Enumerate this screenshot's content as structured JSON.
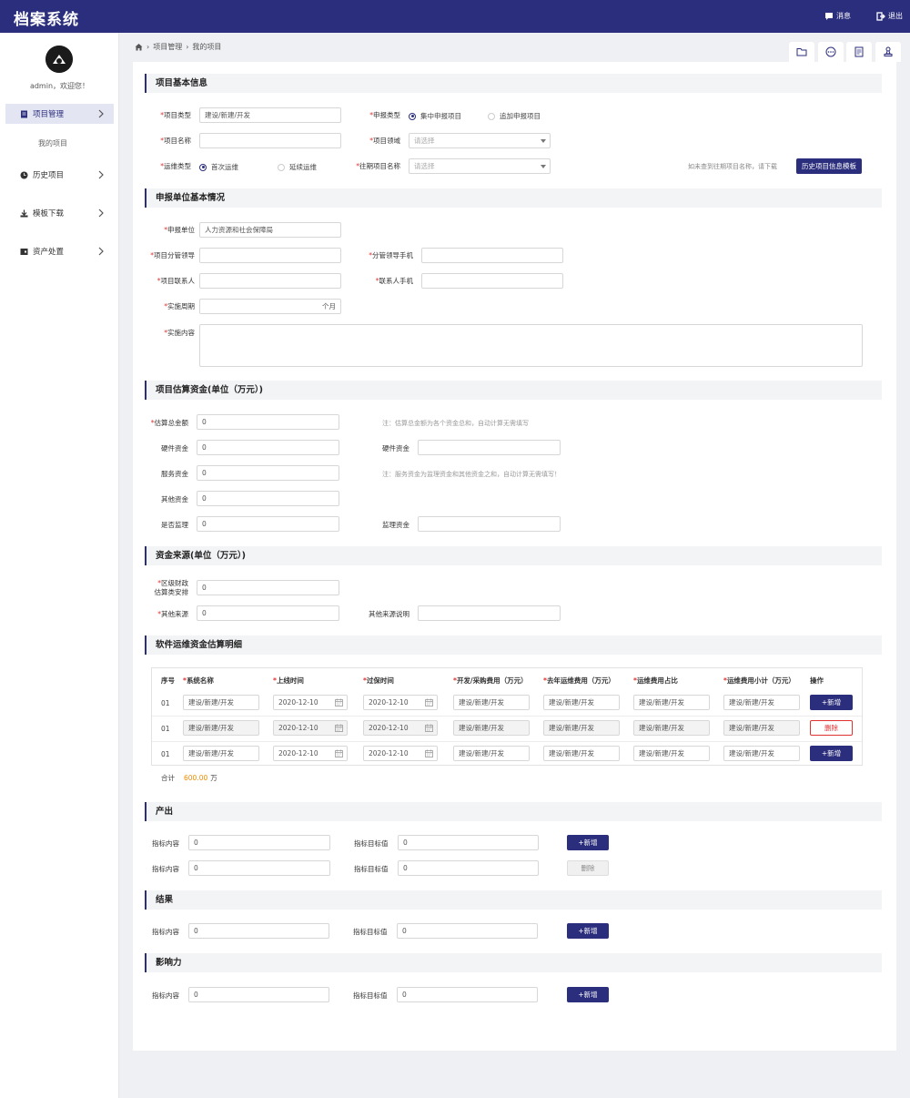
{
  "header": {
    "title": "档案系统",
    "messages_label": "消息",
    "logout_label": "退出"
  },
  "sidebar": {
    "welcome": "admin，欢迎您！",
    "items": [
      {
        "label": "项目管理"
      },
      {
        "label": "历史项目"
      },
      {
        "label": "模板下载"
      },
      {
        "label": "资产处置"
      }
    ],
    "sub_items": [
      {
        "label": "我的项目"
      }
    ]
  },
  "breadcrumb": {
    "items": [
      "项目管理",
      "我的项目"
    ]
  },
  "sections": {
    "basic": "项目基本信息",
    "unit": "申报单位基本情况",
    "budget": "项目估算资金(单位（万元）)",
    "source": "资金来源(单位（万元）)",
    "detail": "软件运维资金估算明细",
    "output": "产出",
    "result": "结果",
    "impact": "影响力"
  },
  "basic": {
    "project_type_label": "项目类型",
    "project_type_value": "建设/新建/开发",
    "apply_type_label": "申报类型",
    "apply_type_opt1": "集中申报项目",
    "apply_type_opt2": "追加申报项目",
    "project_name_label": "项目名称",
    "project_field_label": "项目领域",
    "project_field_placeholder": "请选择",
    "ops_type_label": "运维类型",
    "ops_opt1": "首次运维",
    "ops_opt2": "延续运维",
    "past_name_label": "往期项目名称",
    "past_name_placeholder": "请选择",
    "hint": "如未查到往期项目名称，请下载",
    "history_button": "历史项目信息模板"
  },
  "unit": {
    "apply_unit_label": "申报单位",
    "apply_unit_value": "人力资源和社会保障局",
    "leader_label": "项目分管领导",
    "leader_phone_label": "分管领导手机",
    "contact_label": "项目联系人",
    "contact_phone_label": "联系人手机",
    "period_label": "实施周期",
    "period_unit": "个月",
    "content_label": "实施内容"
  },
  "budget": {
    "total_label": "估算总金额",
    "total_value": "0",
    "total_note": "注：估算总金额为各个资金总和，自动计算无需填写",
    "hardware_label": "硬件资金",
    "hardware_value": "0",
    "hardware2_label": "硬件资金",
    "service_label": "服务资金",
    "service_value": "0",
    "service_note": "注：服务资金为监理资金和其他资金之和，自动计算无需填写！",
    "other_label": "其他资金",
    "other_value": "0",
    "supervise_flag_label": "是否监理",
    "supervise_flag_value": "0",
    "supervise_fund_label": "监理资金"
  },
  "source": {
    "district_label_1": "区级财政",
    "district_label_2": "估算类安排",
    "district_value": "0",
    "other_label": "其他来源",
    "other_value": "0",
    "other_desc_label": "其他来源说明"
  },
  "detail": {
    "headers": [
      "序号",
      "系统名称",
      "上线时间",
      "过保时间",
      "开发/采购费用（万元）",
      "去年运维费用（万元）",
      "运维费用占比",
      "运维费用小计（万元）",
      "操作"
    ],
    "rows": [
      {
        "no": "01",
        "name": "建设/新建/开发",
        "online": "2020-12-10",
        "expire": "2020-12-10",
        "dev": "建设/新建/开发",
        "last": "建设/新建/开发",
        "ratio": "建设/新建/开发",
        "subtotal": "建设/新建/开发",
        "action": "+新增"
      },
      {
        "no": "01",
        "name": "建设/新建/开发",
        "online": "2020-12-10",
        "expire": "2020-12-10",
        "dev": "建设/新建/开发",
        "last": "建设/新建/开发",
        "ratio": "建设/新建/开发",
        "subtotal": "建设/新建/开发",
        "action": "删除"
      },
      {
        "no": "01",
        "name": "建设/新建/开发",
        "online": "2020-12-10",
        "expire": "2020-12-10",
        "dev": "建设/新建/开发",
        "last": "建设/新建/开发",
        "ratio": "建设/新建/开发",
        "subtotal": "建设/新建/开发",
        "action": "+新增"
      }
    ],
    "total_label": "合计",
    "total_value": "600.00",
    "total_unit": "万"
  },
  "indicators": {
    "content_label": "指标内容",
    "target_label": "指标目标值",
    "value": "0",
    "add_button": "+新增",
    "delete_button": "删除"
  },
  "colors": {
    "primary": "#2b2e7c",
    "danger": "#e03131",
    "accent": "#f08c00"
  }
}
